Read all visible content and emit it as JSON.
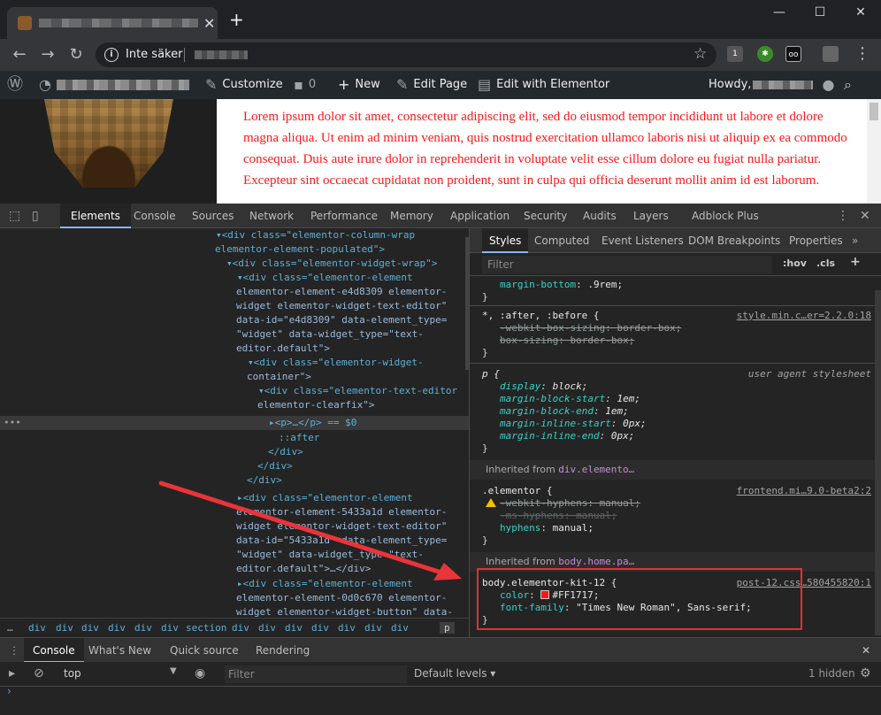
{
  "browser": {
    "new_tab": "+",
    "tab_close": "✕",
    "security_label": "Inte säker",
    "window_controls": [
      "—",
      "☐",
      "✕"
    ]
  },
  "adminbar": {
    "customize": "Customize",
    "comments_count": "0",
    "new": "New",
    "edit_page": "Edit Page",
    "edit_elementor": "Edit with Elementor",
    "howdy": "Howdy,"
  },
  "page": {
    "lorem": "Lorem ipsum dolor sit amet, consectetur adipiscing elit, sed do eiusmod tempor incididunt ut labore et dolore magna aliqua. Ut enim ad minim veniam, quis nostrud exercitation ullamco laboris nisi ut aliquip ex ea commodo consequat. Duis aute irure dolor in reprehenderit in voluptate velit esse cillum dolore eu fugiat nulla pariatur. Excepteur sint occaecat cupidatat non proident, sunt in culpa qui officia deserunt mollit anim id est laborum.",
    "text_color": "#FF1717"
  },
  "devtools": {
    "tabs": [
      "Elements",
      "Console",
      "Sources",
      "Network",
      "Performance",
      "Memory",
      "Application",
      "Security",
      "Audits",
      "Layers",
      "Adblock Plus"
    ],
    "active_tab": "Elements",
    "styles_tabs": [
      "Styles",
      "Computed",
      "Event Listeners",
      "DOM Breakpoints",
      "Properties"
    ],
    "filter_placeholder": "Filter",
    "hov": ":hov",
    "cls": ".cls",
    "breadcrumbs": [
      "div",
      "div",
      "div",
      "div",
      "div",
      "div",
      "section",
      "div",
      "div",
      "div",
      "div",
      "div",
      "div",
      "div",
      "p"
    ],
    "elements_tree": {
      "l1a": "<div class=\"elementor-column-wrap",
      "l1b": "elementor-element-populated\">",
      "l2": "<div class=\"elementor-widget-wrap\">",
      "l3a": "<div class=\"elementor-element",
      "l3b": "elementor-element-e4d8309 elementor-",
      "l3c": "widget elementor-widget-text-editor\"",
      "l3d": "data-id=\"e4d8309\" data-element_type=",
      "l3e": "\"widget\" data-widget_type=\"text-",
      "l3f": "editor.default\">",
      "l4a": "<div class=\"elementor-widget-",
      "l4b": "container\">",
      "l5a": "<div class=\"elementor-text-editor",
      "l5b": "elementor-clearfix\">",
      "l6": "<p>…</p> == $0",
      "l7": "::after",
      "l8": "</div>",
      "l9": "</div>",
      "l10": "</div>",
      "l11a": "<div class=\"elementor-element",
      "l11b": "elementor-element-5433a1d elementor-",
      "l11c": "widget elementor-widget-text-editor\"",
      "l11d": "data-id=\"5433a1d\" data-element_type=",
      "l11e": "\"widget\" data-widget_type=\"text-",
      "l11f": "editor.default\">…</div>",
      "l12a": "<div class=\"elementor-element",
      "l12b": "elementor-element-0d0c670 elementor-",
      "l12c": "widget elementor-widget-button\" data-"
    },
    "styles": {
      "r0_prop": "margin-bottom",
      "r0_val": ".9rem;",
      "r1_sel": "*, :after, :before {",
      "r1_src": "style.min.c…er=2.2.0:18",
      "r1_p1": "-webkit-box-sizing",
      "r1_v1": "border-box;",
      "r1_p2": "box-sizing",
      "r1_v2": "border-box;",
      "r2_sel": "p {",
      "r2_src": "user agent stylesheet",
      "r2_props": [
        {
          "p": "display",
          "v": "block;"
        },
        {
          "p": "margin-block-start",
          "v": "1em;"
        },
        {
          "p": "margin-block-end",
          "v": "1em;"
        },
        {
          "p": "margin-inline-start",
          "v": "0px;"
        },
        {
          "p": "margin-inline-end",
          "v": "0px;"
        }
      ],
      "inh1_label": "Inherited from",
      "inh1_link": "div.elemento…",
      "r3_sel": ".elementor {",
      "r3_src": "frontend.mi…9.0-beta2:2",
      "r3_p1": "-webkit-hyphens",
      "r3_v1": "manual;",
      "r3_p2": "-ms-hyphens",
      "r3_v2": "manual;",
      "r3_p3": "hyphens",
      "r3_v3": "manual;",
      "inh2_label": "Inherited from",
      "inh2_link": "body.home.pa…",
      "r4_sel": "body.elementor-kit-12 {",
      "r4_src": "post-12.css…580455820:1",
      "r4_p1": "color",
      "r4_v1": "#FF1717;",
      "r4_p2": "font-family",
      "r4_v2": "\"Times New Roman\", Sans-serif;",
      "close": "}"
    }
  },
  "drawer": {
    "tabs": [
      "Console",
      "What's New",
      "Quick source",
      "Rendering"
    ],
    "context": "top",
    "filter_placeholder": "Filter",
    "levels": "Default levels ▾",
    "hidden": "1 hidden",
    "prompt": "›"
  },
  "colors": {
    "annotation_red": "#E9343A",
    "swatch": "#FF1717"
  }
}
